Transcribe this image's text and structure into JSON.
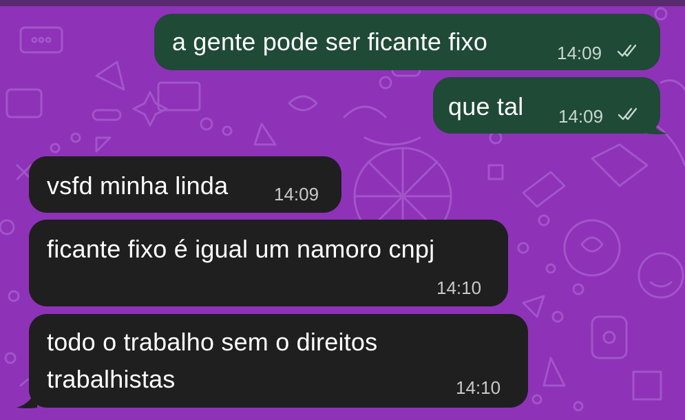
{
  "theme": {
    "chat_background": "#8e32b8",
    "outgoing_bubble": "#1f4a36",
    "incoming_bubble": "#1f1f1f",
    "text_color": "#ffffff",
    "time_color": "#c9c9c9"
  },
  "messages": [
    {
      "direction": "outgoing",
      "text": "a gente pode ser ficante fixo",
      "time": "14:09",
      "status": "read-double-check-icon"
    },
    {
      "direction": "outgoing",
      "text": "que tal",
      "time": "14:09",
      "status": "read-double-check-icon"
    },
    {
      "direction": "incoming",
      "text": "vsfd minha linda",
      "time": "14:09"
    },
    {
      "direction": "incoming",
      "text": "ficante fixo é igual um namoro cnpj",
      "time": "14:10"
    },
    {
      "direction": "incoming",
      "lines": [
        "todo o trabalho sem o direitos",
        "trabalhistas"
      ],
      "time": "14:10"
    }
  ]
}
